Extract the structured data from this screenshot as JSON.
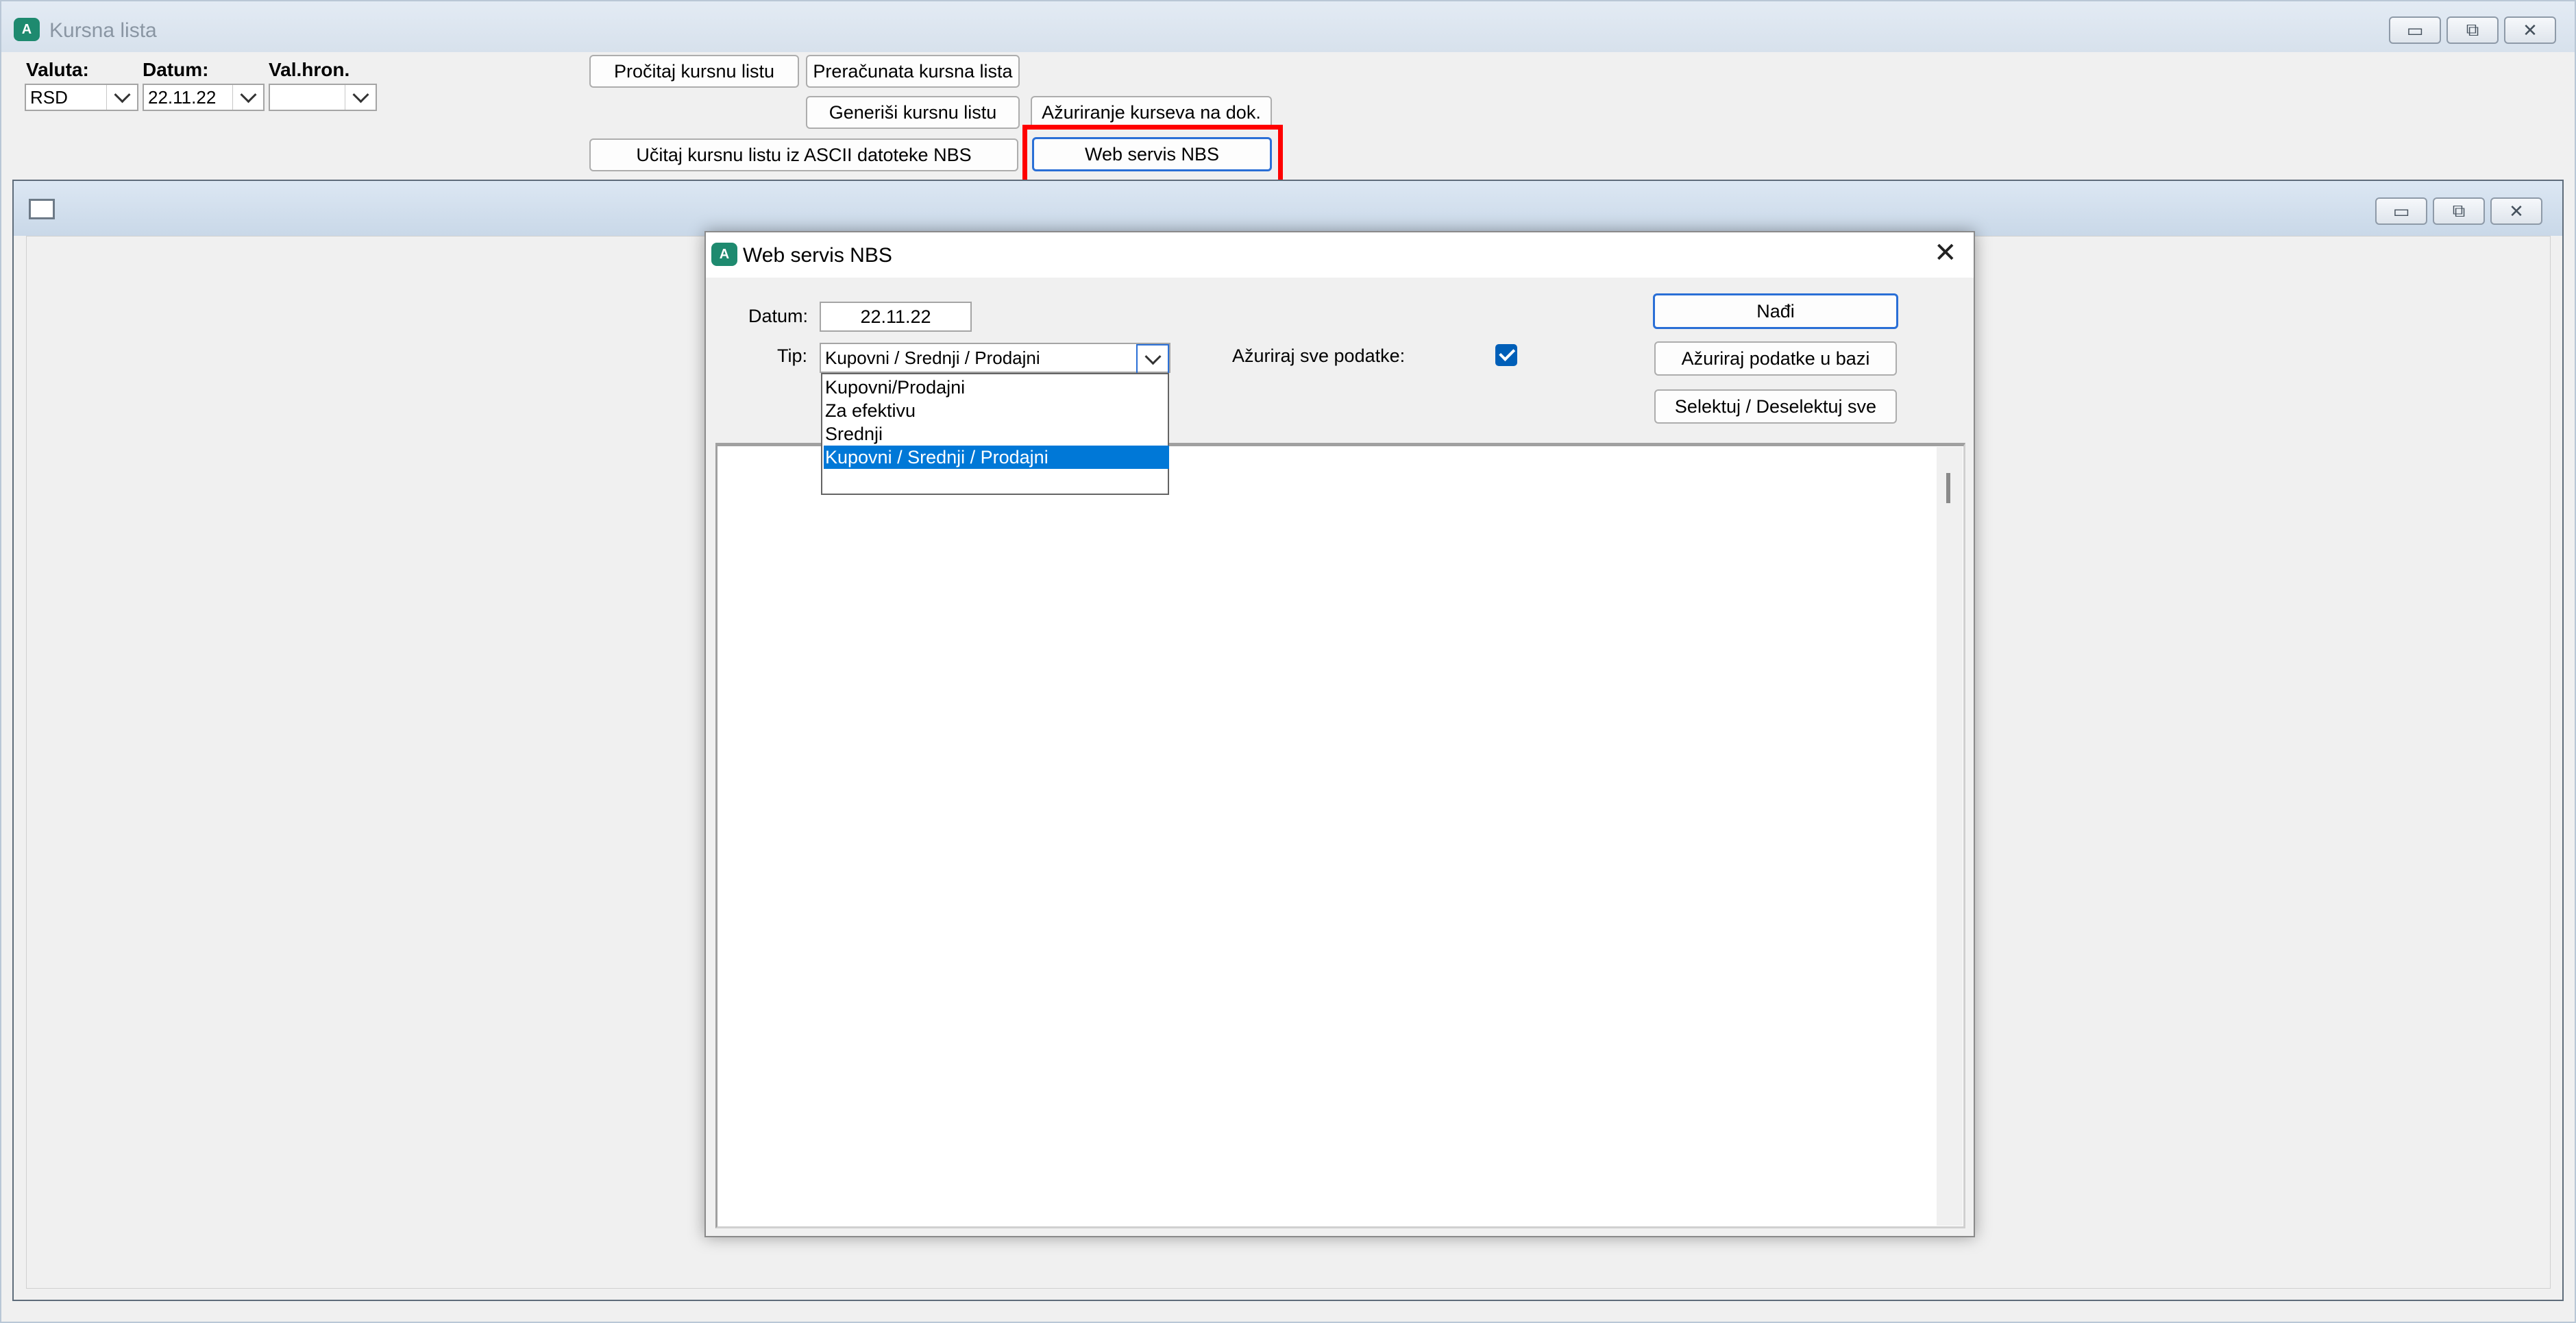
{
  "main_window": {
    "app_icon": "app-logo-icon",
    "title": "Kursna lista",
    "controls": {
      "minimize": "▭",
      "maximize": "⧉",
      "close": "✕"
    }
  },
  "form": {
    "valuta_label": "Valuta:",
    "valuta_value": "RSD",
    "datum_label": "Datum:",
    "datum_value": "22.11.22",
    "valhron_label": "Val.hron.",
    "valhron_value": ""
  },
  "toolbar": {
    "procitaj": "Pročitaj kursnu listu",
    "preracunata": "Preračunata kursna lista",
    "generisi": "Generiši kursnu listu",
    "azuriranje": "Ažuriranje kurseva na dok.",
    "ucitaj_ascii": "Učitaj kursnu listu iz ASCII datoteke NBS",
    "web_servis": "Web servis NBS"
  },
  "mdi_child": {
    "icon": "window-icon",
    "controls": {
      "minimize": "▭",
      "maximize": "⧉",
      "close": "✕"
    }
  },
  "dialog": {
    "title": "Web servis NBS",
    "close": "✕",
    "datum_label": "Datum:",
    "datum_value": "22.11.22",
    "tip_label": "Tip:",
    "tip_value": "Kupovni / Srednji / Prodajni",
    "tip_options": [
      "Kupovni/Prodajni",
      "Za efektivu",
      "Srednji",
      "Kupovni / Srednji / Prodajni"
    ],
    "tip_selected_index": 3,
    "azuriraj_sve_label": "Ažuriraj sve podatke:",
    "azuriraj_sve_checked": true,
    "nadji": "Nađi",
    "azuriraj_bazi": "Ažuriraj podatke u bazi",
    "selektuj": "Selektuj / Deselektuj sve"
  },
  "colors": {
    "highlight": "#ff0000",
    "selection": "#0078d7",
    "checkbox": "#005fb8",
    "app_icon": "#1e8a6f"
  }
}
